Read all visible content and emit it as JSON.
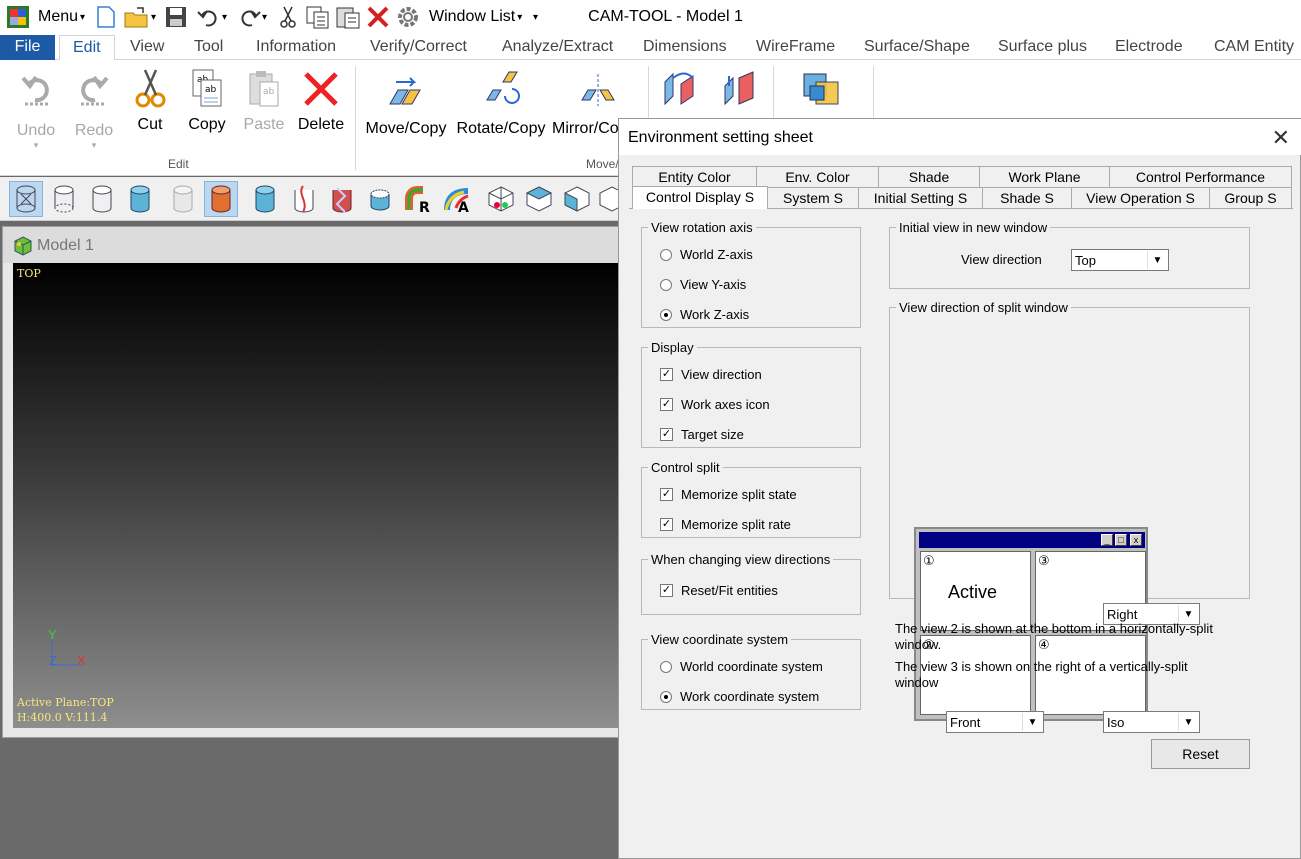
{
  "app": {
    "title": "CAM-TOOL - Model 1",
    "menu_label": "Menu",
    "window_list_label": "Window List"
  },
  "ribbon_tabs": [
    "File",
    "Edit",
    "View",
    "Tool",
    "Information",
    "Verify/Correct",
    "Analyze/Extract",
    "Dimensions",
    "WireFrame",
    "Surface/Shape",
    "Surface plus",
    "Electrode",
    "CAM Entity"
  ],
  "ribbon": {
    "undo": "Undo",
    "redo": "Redo",
    "cut": "Cut",
    "copy": "Copy",
    "paste": "Paste",
    "delete": "Delete",
    "edit_group": "Edit",
    "move_copy": "Move/Copy",
    "rotate_copy": "Rotate/Copy",
    "mirror_copy": "Mirror/Co",
    "move_group": "Move/"
  },
  "model_window": {
    "title": "Model 1",
    "view_label": "TOP",
    "active_plane": "Active Plane:TOP",
    "coords": "H:400.0 V:111.4",
    "axis_y": "Y",
    "axis_z": "Z",
    "axis_x": "X"
  },
  "dialog": {
    "title": "Environment setting sheet",
    "tabs_row1": [
      "Entity Color",
      "Env. Color",
      "Shade",
      "Work Plane",
      "Control Performance"
    ],
    "tabs_row2": [
      "Control Display S",
      "System S",
      "Initial Setting S",
      "Shade S",
      "View Operation S",
      "Group S"
    ],
    "view_rotation_axis": {
      "legend": "View rotation axis",
      "options": [
        "World Z-axis",
        "View Y-axis",
        "Work Z-axis"
      ],
      "selected": "Work Z-axis"
    },
    "display": {
      "legend": "Display",
      "options": [
        "View direction",
        "Work axes icon",
        "Target size"
      ]
    },
    "control_split": {
      "legend": "Control split",
      "options": [
        "Memorize split state",
        "Memorize split rate"
      ]
    },
    "changing_view": {
      "legend": "When changing view directions",
      "options": [
        "Reset/Fit entities"
      ]
    },
    "view_coordinate": {
      "legend": "View coordinate system",
      "options": [
        "World coordinate system",
        "Work coordinate system"
      ],
      "selected": "Work coordinate system"
    },
    "initial_view": {
      "legend": "Initial view in new window",
      "label": "View direction",
      "value": "Top"
    },
    "split_view": {
      "legend": "View direction of split window",
      "active_label": "Active",
      "pane_numbers": [
        "①",
        "②",
        "③",
        "④"
      ],
      "pane3_value": "Right",
      "pane2_value": "Front",
      "pane4_value": "Iso"
    },
    "note1": "The view 2 is shown at the bottom in a horizontally-split window.",
    "note2": "The view 3 is shown on the right of a vertically-split window",
    "reset_label": "Reset"
  }
}
